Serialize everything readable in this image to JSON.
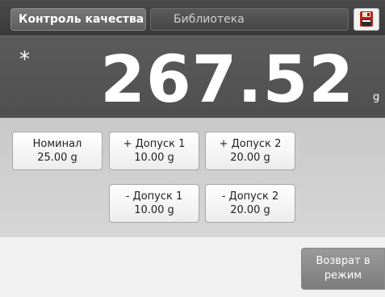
{
  "header": {
    "mode_tab": "Контроль качества",
    "library_tab": "Библиотека",
    "save_icon": "floppy-disk-icon"
  },
  "display": {
    "indicator": "*",
    "weight": "267.52",
    "unit": "g"
  },
  "params": {
    "nominal": {
      "label": "Номинал",
      "value": "25.00 g"
    },
    "plus_tol1": {
      "label": "+ Допуск 1",
      "value": "10.00 g"
    },
    "plus_tol2": {
      "label": "+ Допуск 2",
      "value": "20.00 g"
    },
    "minus_tol1": {
      "label": "- Допуск 1",
      "value": "10.00 g"
    },
    "minus_tol2": {
      "label": "- Допуск 2",
      "value": "20.00 g"
    }
  },
  "footer": {
    "return_line1": "Возврат в",
    "return_line2": "режим"
  }
}
